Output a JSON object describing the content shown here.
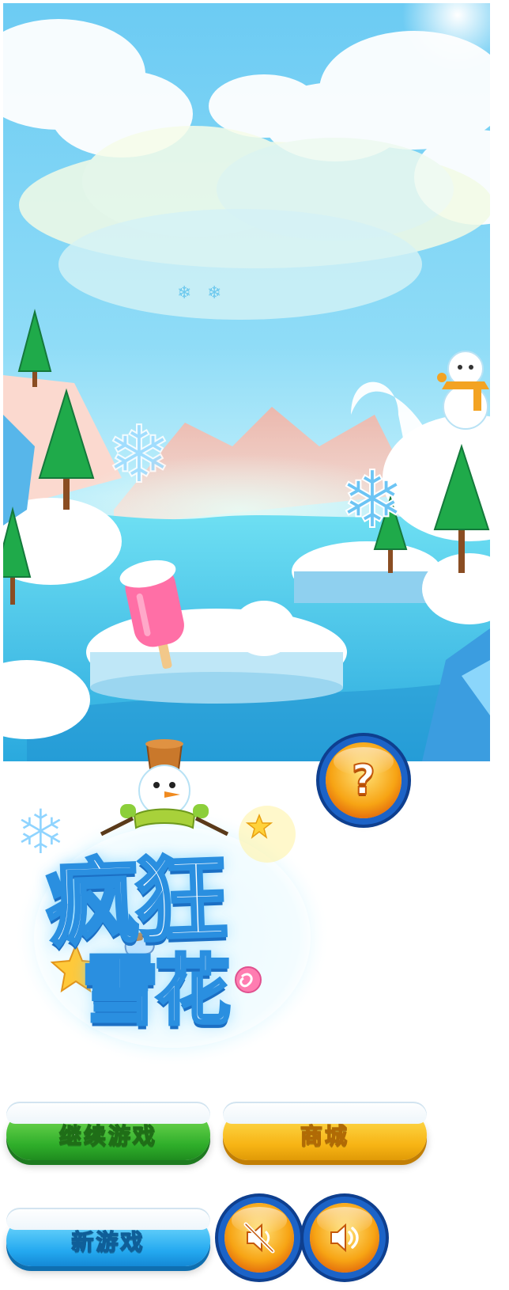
{
  "logo": {
    "line1": "疯狂",
    "line2": "雪花"
  },
  "menu": {
    "continue_label": "继续游戏",
    "shop_label": "商城",
    "new_game_label": "新游戏",
    "help_label": "?"
  },
  "icons": {
    "help": "question-mark-icon",
    "mute": "speaker-muted-icon",
    "sound": "speaker-on-icon"
  },
  "colors": {
    "sky": "#7cd4f5",
    "water": "#48c3e8",
    "snow": "#ffffff",
    "button_green": "#2fae2a",
    "button_yellow": "#f7b414",
    "button_blue": "#24a9f0",
    "round_button": "#f7a414",
    "round_ring": "#1c63c7"
  }
}
